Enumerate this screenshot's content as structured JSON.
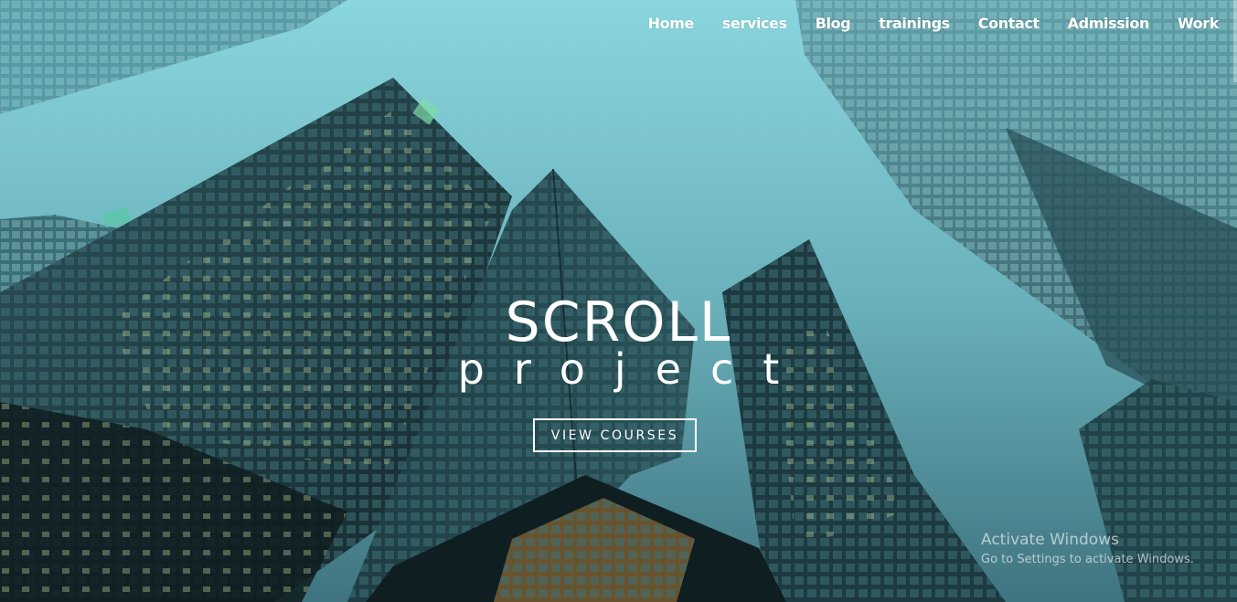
{
  "nav": {
    "items": [
      {
        "label": "Home"
      },
      {
        "label": "services"
      },
      {
        "label": "Blog"
      },
      {
        "label": "trainings"
      },
      {
        "label": "Contact"
      },
      {
        "label": "Admission"
      },
      {
        "label": "Work"
      }
    ]
  },
  "hero": {
    "title": "SCROLL",
    "subtitle": "project",
    "cta_label": "VIEW COURSES"
  },
  "watermark": {
    "title": "Activate Windows",
    "subtitle": "Go to Settings to activate Windows."
  },
  "colors": {
    "sky": "#86d3dc",
    "building_dark": "#1c3c42",
    "text": "#ffffff"
  }
}
